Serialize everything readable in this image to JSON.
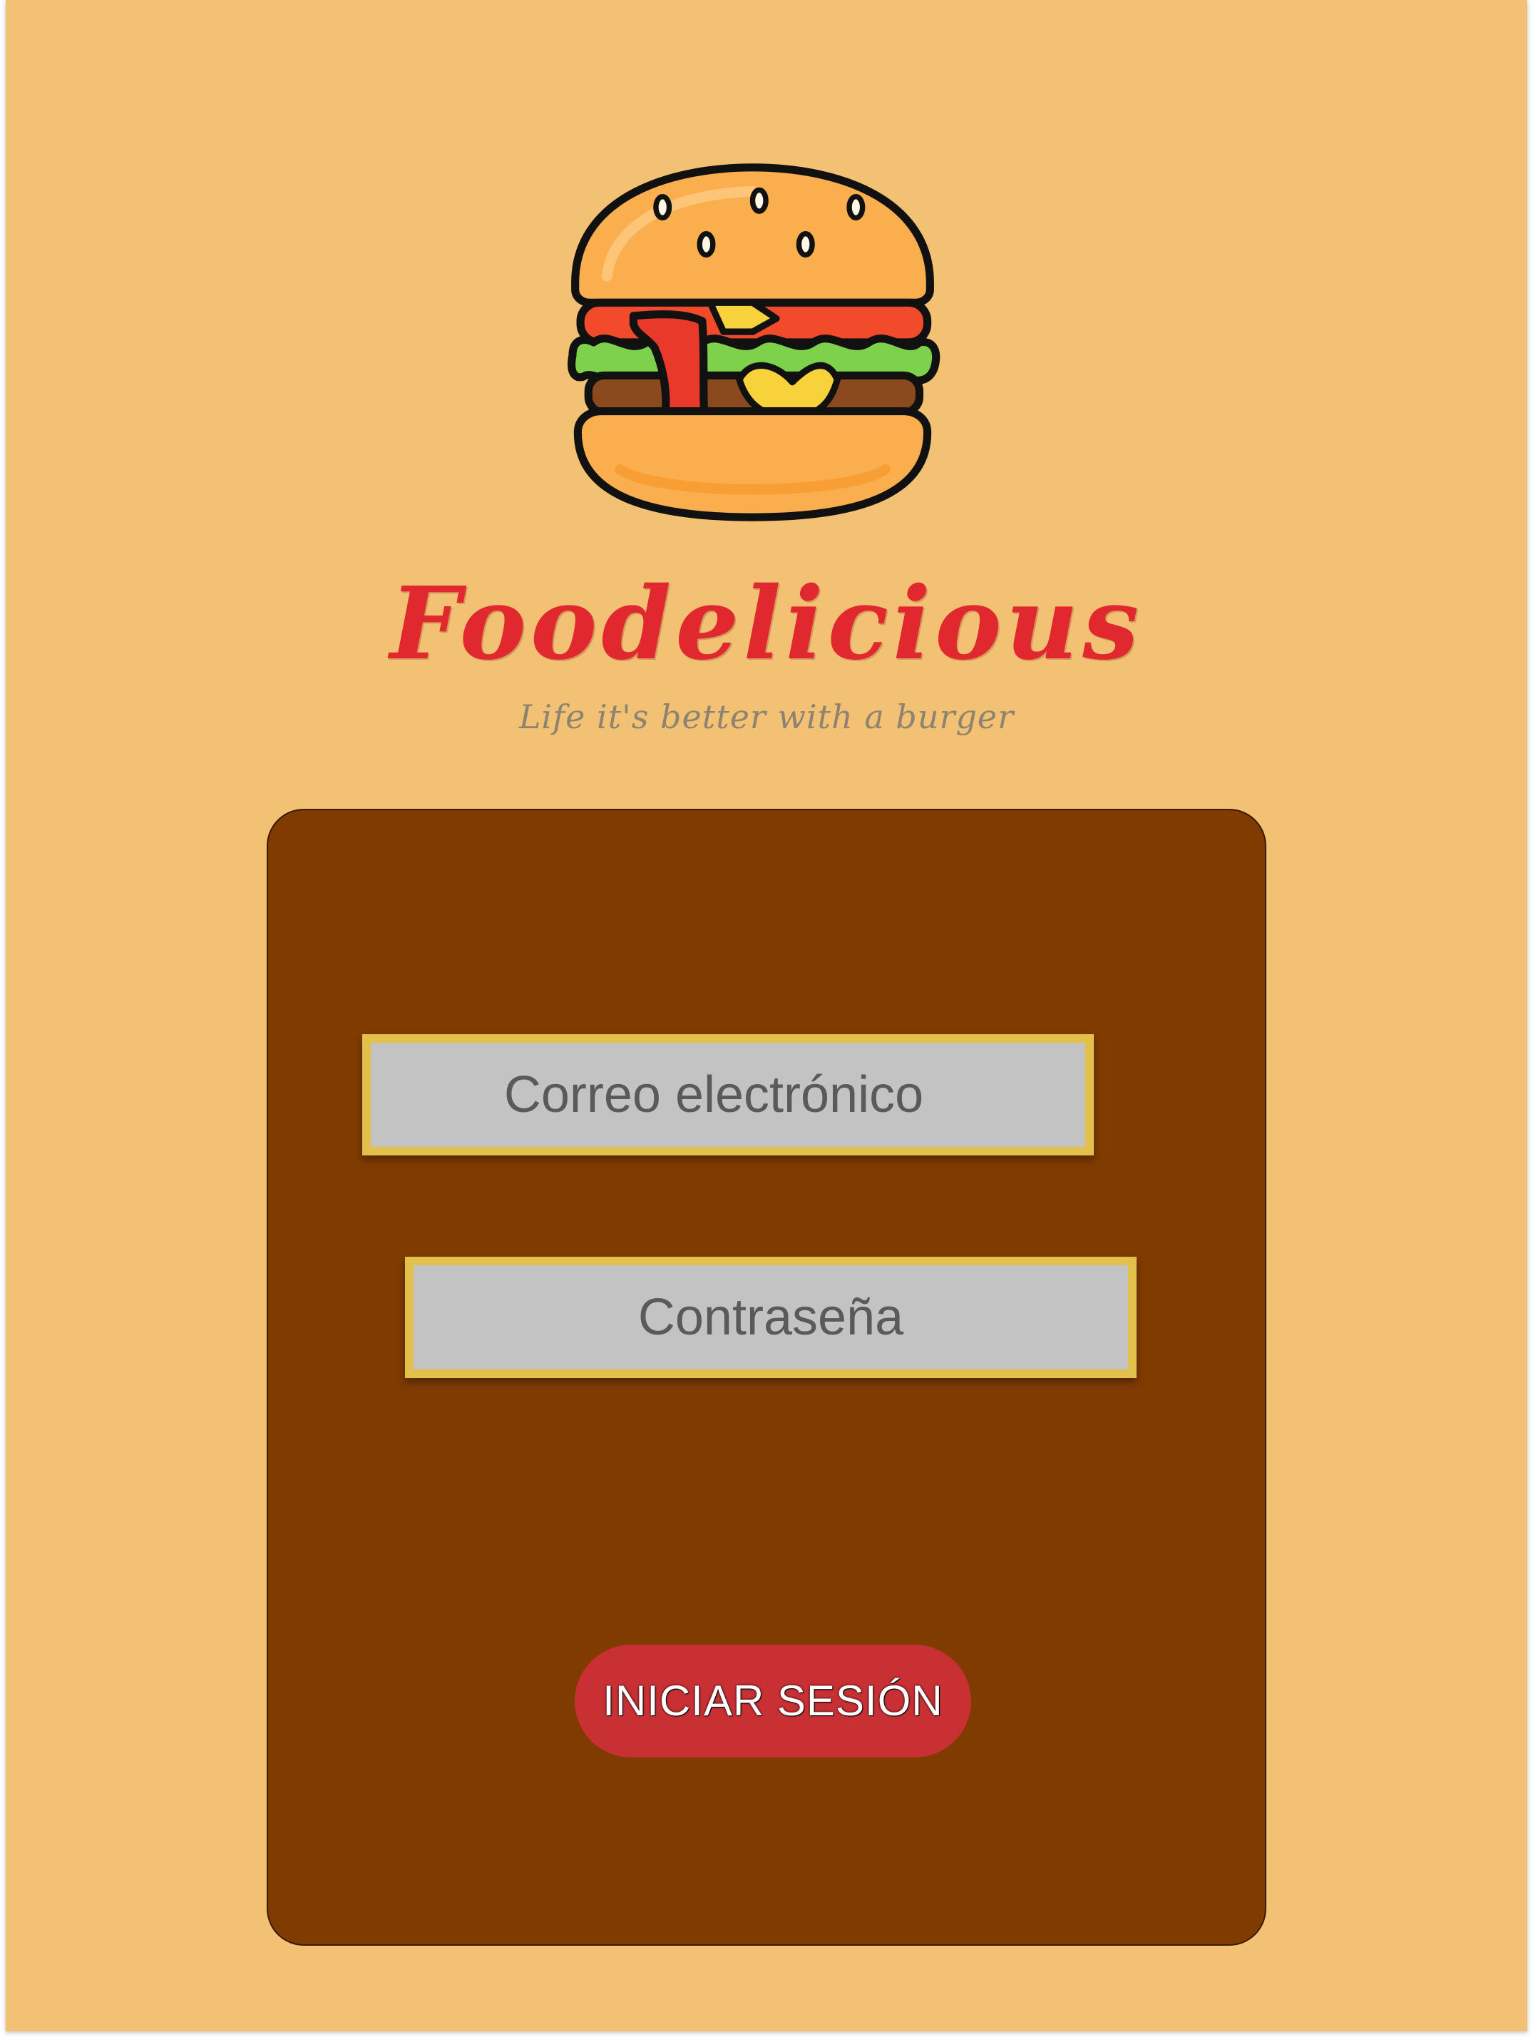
{
  "brand": {
    "name": "Foodelicious",
    "tagline": "Life it's better with a burger",
    "logo_icon": "burger-icon"
  },
  "login_form": {
    "email_placeholder": "Correo electrónico",
    "password_placeholder": "Contraseña",
    "submit_label": "INICIAR SESIÓN"
  },
  "colors": {
    "background": "#f3c174",
    "card": "#7f3b00",
    "field": "#c3c3c3",
    "field_border": "#e2c04c",
    "button": "#c83034",
    "brand_text": "#e0282e"
  }
}
